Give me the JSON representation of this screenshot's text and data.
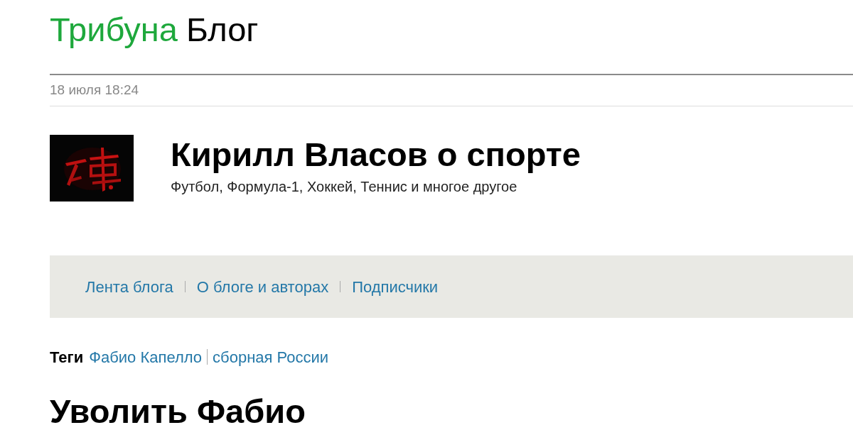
{
  "logo": {
    "brand": "Трибуна",
    "section": "Блог"
  },
  "date": "18 июля 18:24",
  "blog": {
    "title": "Кирилл Власов о спорте",
    "subtitle": "Футбол, Формула-1, Хоккей, Теннис и многое другое"
  },
  "nav": [
    {
      "label": "Лента блога"
    },
    {
      "label": "О блоге и авторах"
    },
    {
      "label": "Подписчики"
    }
  ],
  "tags": {
    "label": "Теги",
    "items": [
      "Фабио Капелло",
      "сборная России"
    ]
  },
  "post_title": "Уволить Фабио"
}
